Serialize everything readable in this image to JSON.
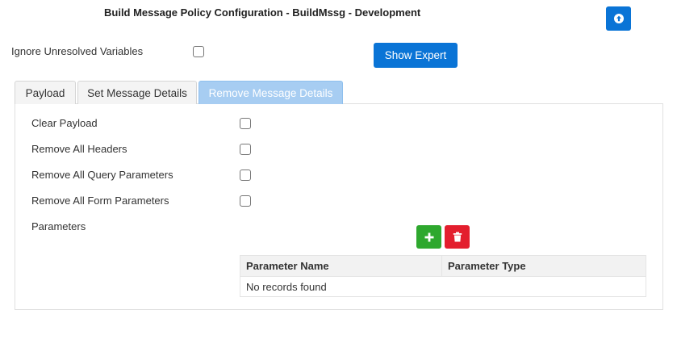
{
  "header": {
    "title": "Build Message Policy Configuration - BuildMssg - Development",
    "upload_icon": "arrow-up-circle-icon"
  },
  "settings": {
    "ignore_unresolved_label": "Ignore Unresolved Variables",
    "ignore_unresolved_checked": false,
    "show_expert_label": "Show Expert"
  },
  "tabs": [
    {
      "label": "Payload",
      "active": false
    },
    {
      "label": "Set Message Details",
      "active": false
    },
    {
      "label": "Remove Message Details",
      "active": true
    }
  ],
  "remove_details": {
    "options": [
      {
        "label": "Clear Payload",
        "checked": false
      },
      {
        "label": "Remove All Headers",
        "checked": false
      },
      {
        "label": "Remove All Query Parameters",
        "checked": false
      },
      {
        "label": "Remove All Form Parameters",
        "checked": false
      }
    ],
    "parameters_label": "Parameters",
    "add_icon": "plus-icon",
    "delete_icon": "trash-icon",
    "table": {
      "columns": [
        "Parameter Name",
        "Parameter Type"
      ],
      "empty_message": "No records found"
    }
  },
  "colors": {
    "primary": "#0a74d6",
    "active_tab": "#a7cdf2",
    "add": "#2ea82e",
    "delete": "#e31e2d"
  }
}
